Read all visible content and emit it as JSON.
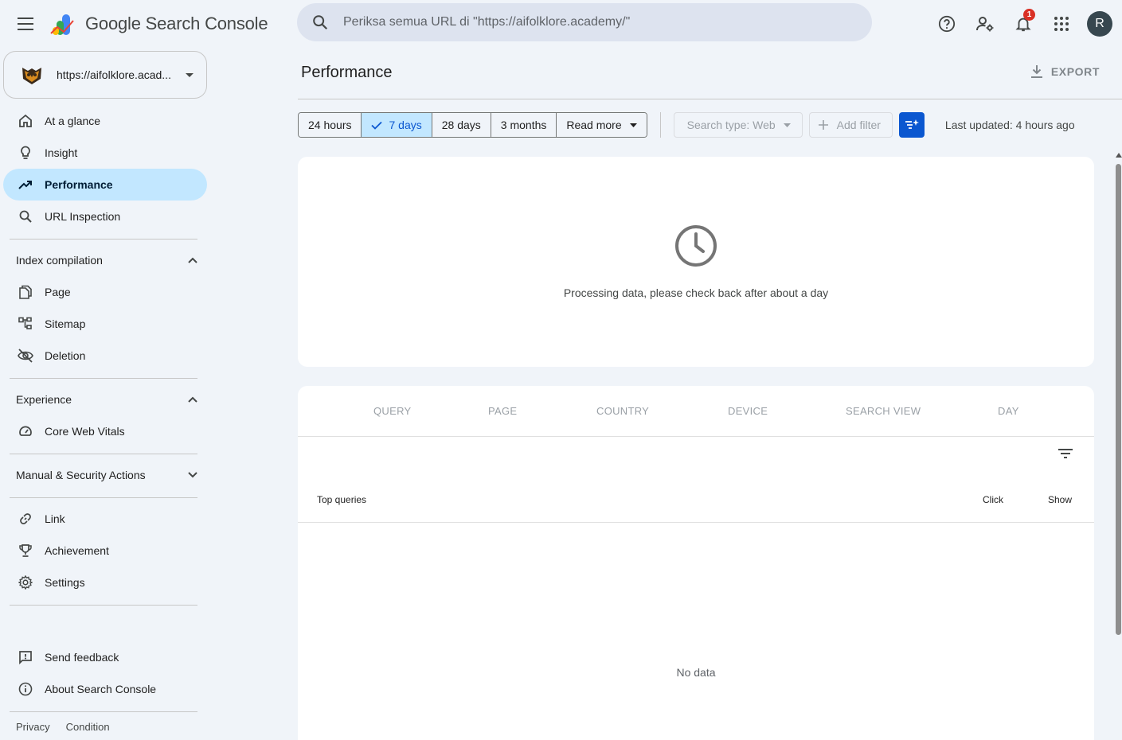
{
  "app": {
    "title": "Google Search Console"
  },
  "search": {
    "placeholder": "Periksa semua URL di \"https://aifolklore.academy/\""
  },
  "header": {
    "notification_count": "1",
    "avatar_letter": "R"
  },
  "property": {
    "label": "https://aifolklore.acad..."
  },
  "sidebar": {
    "main_items": [
      {
        "label": "At a glance",
        "icon": "home-icon"
      },
      {
        "label": "Insight",
        "icon": "lightbulb-icon"
      },
      {
        "label": "Performance",
        "icon": "trending-up-icon"
      },
      {
        "label": "URL Inspection",
        "icon": "search-icon"
      }
    ],
    "index_section": "Index compilation",
    "index_items": [
      {
        "label": "Page",
        "icon": "pages-icon"
      },
      {
        "label": "Sitemap",
        "icon": "sitemap-icon"
      },
      {
        "label": "Deletion",
        "icon": "eye-off-icon"
      }
    ],
    "experience_section": "Experience",
    "experience_items": [
      {
        "label": "Core Web Vitals",
        "icon": "speed-icon"
      }
    ],
    "security_section": "Manual & Security Actions",
    "other_items": [
      {
        "label": "Link",
        "icon": "link-icon"
      },
      {
        "label": "Achievement",
        "icon": "trophy-icon"
      },
      {
        "label": "Settings",
        "icon": "gear-icon"
      }
    ],
    "footer_items": [
      {
        "label": "Send feedback",
        "icon": "feedback-icon"
      },
      {
        "label": "About Search Console",
        "icon": "info-icon"
      }
    ],
    "legal": {
      "privacy": "Privacy",
      "condition": "Condition"
    }
  },
  "main": {
    "title": "Performance",
    "export_label": "EXPORT",
    "date_ranges": [
      "24 hours",
      "7 days",
      "28 days",
      "3 months",
      "Read more"
    ],
    "selected_range": "7 days",
    "search_type": "Search type: Web",
    "add_filter": "Add filter",
    "last_updated": "Last updated: 4 hours ago",
    "processing_message": "Processing data, please check back after about a day",
    "tabs": [
      "QUERY",
      "PAGE",
      "COUNTRY",
      "DEVICE",
      "SEARCH VIEW",
      "DAY"
    ],
    "table": {
      "col_query": "Top queries",
      "col_click": "Click",
      "col_show": "Show"
    },
    "no_data": "No data"
  },
  "colors": {
    "accent": "#0b57d0",
    "active_nav": "#c2e7ff",
    "background": "#f0f4f9",
    "badge": "#d93025"
  }
}
